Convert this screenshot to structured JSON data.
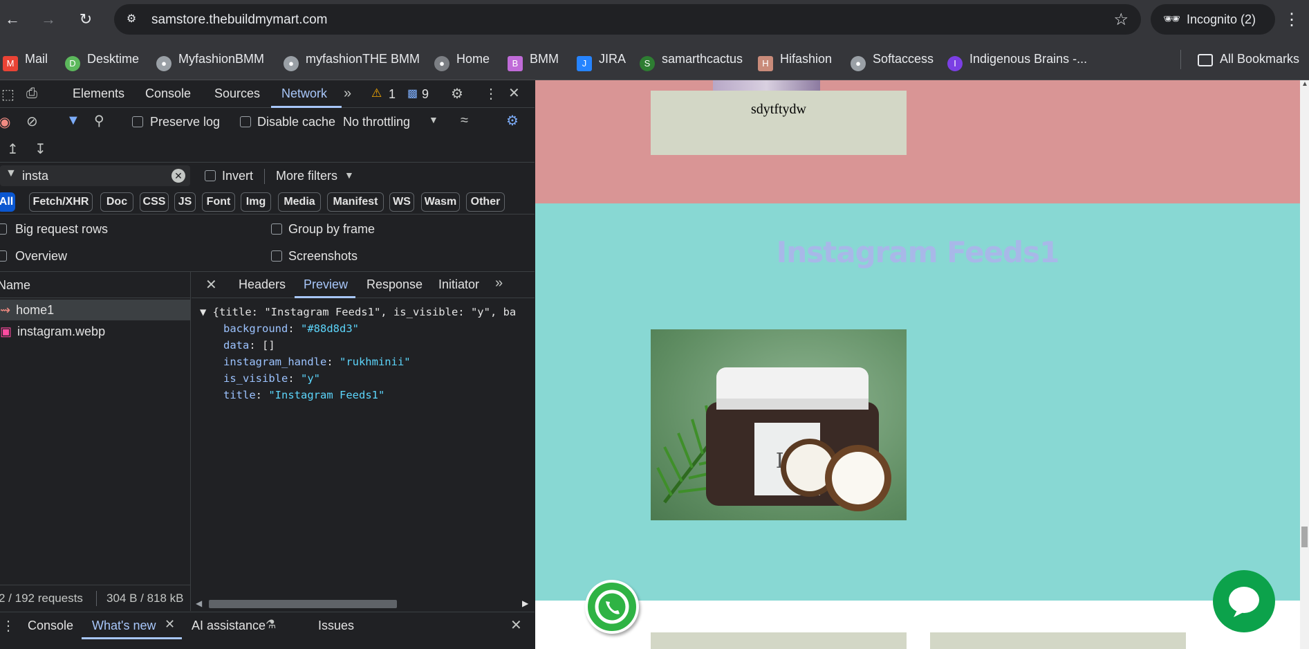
{
  "browser": {
    "url": "samstore.thebuildmymart.com",
    "incognito_label": "Incognito (2)"
  },
  "bookmarks": {
    "items": [
      {
        "label": "Mail",
        "icon": "gmail-icon",
        "color": "#ea4335"
      },
      {
        "label": "Desktime",
        "icon": "desktime-icon",
        "color": "#5cb85c"
      },
      {
        "label": "MyfashionBMM",
        "icon": "globe-icon",
        "color": "#9aa0a6"
      },
      {
        "label": "myfashionTHE BMM",
        "icon": "globe-icon",
        "color": "#9aa0a6"
      },
      {
        "label": "Home",
        "icon": "globe-icon",
        "color": "#7c7f84"
      },
      {
        "label": "BMM",
        "icon": "bmm-icon",
        "color": "#c06bd8"
      },
      {
        "label": "JIRA",
        "icon": "jira-icon",
        "color": "#2684ff"
      },
      {
        "label": "samarthcactus",
        "icon": "samarthcactus-icon",
        "color": "#2e7d32"
      },
      {
        "label": "Hifashion",
        "icon": "hifashion-icon",
        "color": "#c98b7a"
      },
      {
        "label": "Softaccess",
        "icon": "globe-icon",
        "color": "#9aa0a6"
      },
      {
        "label": "Indigenous Brains -...",
        "icon": "indigenous-icon",
        "color": "#7b3fe4"
      }
    ],
    "all_label": "All Bookmarks"
  },
  "devtools": {
    "tabs": [
      "Elements",
      "Console",
      "Sources",
      "Network"
    ],
    "active_tab": "Network",
    "warnings": "1",
    "messages": "9",
    "preserve_log": "Preserve log",
    "disable_cache": "Disable cache",
    "throttling": "No throttling",
    "filter_value": "insta",
    "invert": "Invert",
    "more_filters": "More filters",
    "chips": [
      "All",
      "Fetch/XHR",
      "Doc",
      "CSS",
      "JS",
      "Font",
      "Img",
      "Media",
      "Manifest",
      "WS",
      "Wasm",
      "Other"
    ],
    "options": {
      "big_rows": "Big request rows",
      "group_frame": "Group by frame",
      "overview": "Overview",
      "screenshots": "Screenshots"
    },
    "name_header": "Name",
    "requests": [
      "home1",
      "instagram.webp"
    ],
    "footer_requests": "2 / 192 requests",
    "footer_size": "304 B / 818 kB",
    "preview_tabs": [
      "Headers",
      "Preview",
      "Response",
      "Initiator"
    ],
    "json_summary": "{title: \"Instagram Feeds1\", is_visible: \"y\", ba",
    "json_rows": [
      {
        "key": "background",
        "value": "\"#88d8d3\""
      },
      {
        "key": "data",
        "value": "[]"
      },
      {
        "key": "instagram_handle",
        "value": "\"rukhminii\""
      },
      {
        "key": "is_visible",
        "value": "\"y\""
      },
      {
        "key": "title",
        "value": "\"Instagram Feeds1\""
      }
    ],
    "drawer_tabs": [
      "Console",
      "What's new",
      "AI assistance",
      "Issues"
    ]
  },
  "page": {
    "card_text": "sdytftydw",
    "section_title": "Instagram Feeds1",
    "colors": {
      "pink": "#d99595",
      "teal": "#88d8d3",
      "title": "#a8b8e8"
    },
    "product_logo": "IS"
  }
}
